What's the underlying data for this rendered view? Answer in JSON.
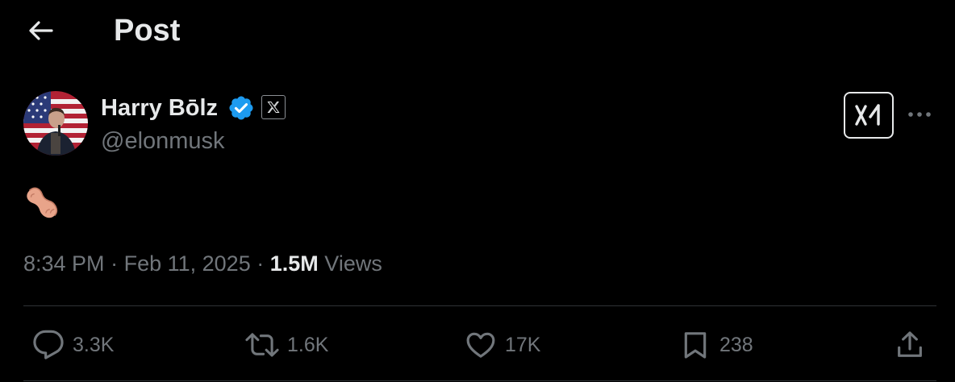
{
  "header": {
    "title": "Post",
    "back_icon": "arrow-left-icon"
  },
  "author": {
    "display_name": "Harry Bōlz",
    "handle": "@elonmusk",
    "verified_icon": "verified-badge-icon",
    "affiliate_icon": "x-logo-icon",
    "verified_color": "#1d9bf0"
  },
  "post": {
    "emoji_icon": "peanut-emoji-icon"
  },
  "meta": {
    "time": "8:34 PM",
    "separator": "·",
    "date": "Feb 11, 2025",
    "views_count": "1.5M",
    "views_label": "Views"
  },
  "top_actions": {
    "grok_icon": "grok-logo-icon",
    "more_icon": "more-horizontal-icon"
  },
  "actions": {
    "replies": {
      "icon": "reply-icon",
      "count": "3.3K"
    },
    "reposts": {
      "icon": "repost-icon",
      "count": "1.6K"
    },
    "likes": {
      "icon": "heart-icon",
      "count": "17K"
    },
    "bookmarks": {
      "icon": "bookmark-icon",
      "count": "238"
    },
    "share": {
      "icon": "share-icon"
    }
  },
  "colors": {
    "background": "#000000",
    "primary_text": "#e7e9ea",
    "secondary_text": "#71767b",
    "divider": "#2f3336"
  }
}
